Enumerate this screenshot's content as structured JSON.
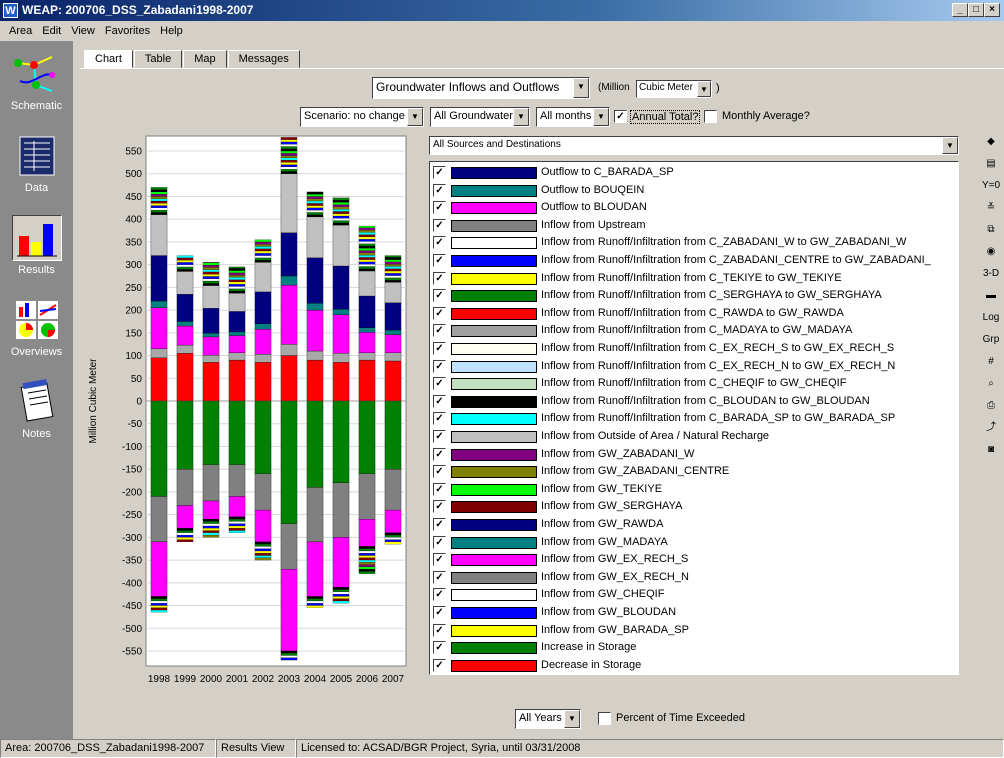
{
  "window": {
    "title": "WEAP: 200706_DSS_Zabadani1998-2007",
    "icon_letter": "W"
  },
  "menu": [
    "Area",
    "Edit",
    "View",
    "Favorites",
    "Help"
  ],
  "sidebar": [
    {
      "label": "Schematic",
      "icon": "schematic-icon"
    },
    {
      "label": "Data",
      "icon": "data-icon"
    },
    {
      "label": "Results",
      "icon": "results-icon"
    },
    {
      "label": "Overviews",
      "icon": "overviews-icon"
    },
    {
      "label": "Notes",
      "icon": "notes-icon"
    }
  ],
  "tabs": [
    "Chart",
    "Table",
    "Map",
    "Messages"
  ],
  "controls": {
    "variable": "Groundwater Inflows and Outflows",
    "unit_prefix": "(Million",
    "unit": "Cubic Meter",
    "unit_suffix": ")",
    "scenario": "Scenario: no change",
    "groundwater": "All Groundwater",
    "months": "All months",
    "annual_total": "Annual Total?",
    "monthly_average": "Monthly Average?",
    "sources": "All Sources and Destinations",
    "years": "All Years",
    "percent_exceeded": "Percent of Time Exceeded"
  },
  "chart_data": {
    "type": "bar",
    "stacked": true,
    "categories": [
      "1998",
      "1999",
      "2000",
      "2001",
      "2002",
      "2003",
      "2004",
      "2005",
      "2006",
      "2007"
    ],
    "ylabel": "Million Cubic Meter",
    "ylim": [
      -550,
      550
    ],
    "yticks": [
      550,
      500,
      450,
      400,
      350,
      300,
      250,
      200,
      150,
      100,
      50,
      0,
      -50,
      -100,
      -150,
      -200,
      -250,
      -300,
      -350,
      -400,
      -450,
      -500,
      -550
    ],
    "grid": true,
    "series": [
      {
        "name": "Decrease in Storage",
        "color": "#ff0000",
        "values": [
          95,
          105,
          85,
          90,
          85,
          100,
          90,
          85,
          90,
          88
        ]
      },
      {
        "name": "Inflow from Outside of Area / Natural Recharge",
        "color": "#a8a8a8",
        "values": [
          20,
          18,
          16,
          16,
          18,
          25,
          20,
          20,
          16,
          18
        ]
      },
      {
        "name": "Outflow to BLOUDAN",
        "color": "#ff00ff",
        "values": [
          90,
          42,
          40,
          38,
          55,
          130,
          90,
          85,
          45,
          40
        ]
      },
      {
        "name": "Outflow to BOUQEIN",
        "color": "#008080",
        "values": [
          15,
          10,
          8,
          8,
          12,
          20,
          15,
          12,
          10,
          10
        ]
      },
      {
        "name": "Outflow to C_BARADA_SP",
        "color": "#000080",
        "values": [
          100,
          60,
          55,
          45,
          70,
          95,
          100,
          95,
          70,
          60
        ]
      },
      {
        "name": "Inflow from Upstream",
        "color": "#c0c0c0",
        "values": [
          90,
          50,
          50,
          40,
          65,
          130,
          90,
          90,
          55,
          45
        ]
      },
      {
        "name": "Increase in Storage",
        "color": "#008000",
        "values": [
          -210,
          -150,
          -140,
          -140,
          -160,
          -270,
          -190,
          -180,
          -160,
          -150
        ]
      },
      {
        "name": "Inflow from GW_EX_RECH_N",
        "color": "#808080",
        "values": [
          -100,
          -80,
          -80,
          -70,
          -80,
          -100,
          -120,
          -120,
          -100,
          -90
        ]
      },
      {
        "name": "Inflow from GW_EX_RECH_S",
        "color": "#ff00ff",
        "values": [
          -120,
          -50,
          -40,
          -45,
          -70,
          -180,
          -120,
          -110,
          -60,
          -50
        ]
      }
    ],
    "totals_positive": [
      470,
      320,
      305,
      295,
      355,
      580,
      460,
      450,
      385,
      320
    ],
    "totals_negative": [
      -465,
      -310,
      -300,
      -290,
      -350,
      -570,
      -455,
      -445,
      -380,
      -315
    ]
  },
  "legend": [
    {
      "label": "Outflow to C_BARADA_SP",
      "color": "#000080"
    },
    {
      "label": "Outflow to BOUQEIN",
      "color": "#008080"
    },
    {
      "label": "Outflow to BLOUDAN",
      "color": "#ff00ff"
    },
    {
      "label": "Inflow from Upstream",
      "color": "#808080"
    },
    {
      "label": "Inflow from Runoff/Infiltration from C_ZABADANI_W to GW_ZABADANI_W",
      "color": "#ffffff"
    },
    {
      "label": "Inflow from Runoff/Infiltration from C_ZABADANI_CENTRE to GW_ZABADANI_",
      "color": "#0000ff"
    },
    {
      "label": "Inflow from Runoff/Infiltration from C_TEKIYE to GW_TEKIYE",
      "color": "#ffff00"
    },
    {
      "label": "Inflow from Runoff/Infiltration from C_SERGHAYA to GW_SERGHAYA",
      "color": "#008000"
    },
    {
      "label": "Inflow from Runoff/Infiltration from C_RAWDA to GW_RAWDA",
      "color": "#ff0000"
    },
    {
      "label": "Inflow from Runoff/Infiltration from C_MADAYA to GW_MADAYA",
      "color": "#a0a0a0"
    },
    {
      "label": "Inflow from Runoff/Infiltration from C_EX_RECH_S to GW_EX_RECH_S",
      "color": "#fffff0"
    },
    {
      "label": "Inflow from Runoff/Infiltration from C_EX_RECH_N to GW_EX_RECH_N",
      "color": "#c0e0ff"
    },
    {
      "label": "Inflow from Runoff/Infiltration from C_CHEQIF to GW_CHEQIF",
      "color": "#c0e0c0"
    },
    {
      "label": "Inflow from Runoff/Infiltration from C_BLOUDAN to GW_BLOUDAN",
      "color": "#000000"
    },
    {
      "label": "Inflow from Runoff/Infiltration from C_BARADA_SP to GW_BARADA_SP",
      "color": "#00ffff"
    },
    {
      "label": "Inflow from Outside of Area / Natural Recharge",
      "color": "#c0c0c0"
    },
    {
      "label": "Inflow from GW_ZABADANI_W",
      "color": "#800080"
    },
    {
      "label": "Inflow from GW_ZABADANI_CENTRE",
      "color": "#808000"
    },
    {
      "label": "Inflow from GW_TEKIYE",
      "color": "#00ff00"
    },
    {
      "label": "Inflow from GW_SERGHAYA",
      "color": "#800000"
    },
    {
      "label": "Inflow from GW_RAWDA",
      "color": "#000080"
    },
    {
      "label": "Inflow from GW_MADAYA",
      "color": "#008080"
    },
    {
      "label": "Inflow from GW_EX_RECH_S",
      "color": "#ff00ff"
    },
    {
      "label": "Inflow from GW_EX_RECH_N",
      "color": "#808080"
    },
    {
      "label": "Inflow from GW_CHEQIF",
      "color": "#ffffff"
    },
    {
      "label": "Inflow from GW_BLOUDAN",
      "color": "#0000ff"
    },
    {
      "label": "Inflow from GW_BARADA_SP",
      "color": "#ffff00"
    },
    {
      "label": "Increase in Storage",
      "color": "#008000"
    },
    {
      "label": "Decrease in Storage",
      "color": "#ff0000"
    }
  ],
  "right_toolbar": [
    {
      "icon": "color-palette-icon",
      "glyph": "◆"
    },
    {
      "icon": "chart-type-icon",
      "glyph": "▤"
    },
    {
      "icon": "y-zero-icon",
      "glyph": "Y=0"
    },
    {
      "icon": "stack-icon",
      "glyph": "≚"
    },
    {
      "icon": "copy-icon",
      "glyph": "⧉"
    },
    {
      "icon": "pie-icon",
      "glyph": "◉"
    },
    {
      "icon": "3d-icon",
      "glyph": "3-D"
    },
    {
      "icon": "line-width-icon",
      "glyph": "▬"
    },
    {
      "icon": "log-scale-icon",
      "glyph": "Log"
    },
    {
      "icon": "group-icon",
      "glyph": "Grp"
    },
    {
      "icon": "grid-icon",
      "glyph": "#"
    },
    {
      "icon": "zoom-icon",
      "glyph": "⌕"
    },
    {
      "icon": "print-icon",
      "glyph": "⎙"
    },
    {
      "icon": "export-icon",
      "glyph": "⤴"
    },
    {
      "icon": "camera-icon",
      "glyph": "◙"
    }
  ],
  "status": {
    "area": "Area: 200706_DSS_Zabadani1998-2007",
    "view": "Results View",
    "license": "Licensed to: ACSAD/BGR Project, Syria, until 03/31/2008"
  }
}
